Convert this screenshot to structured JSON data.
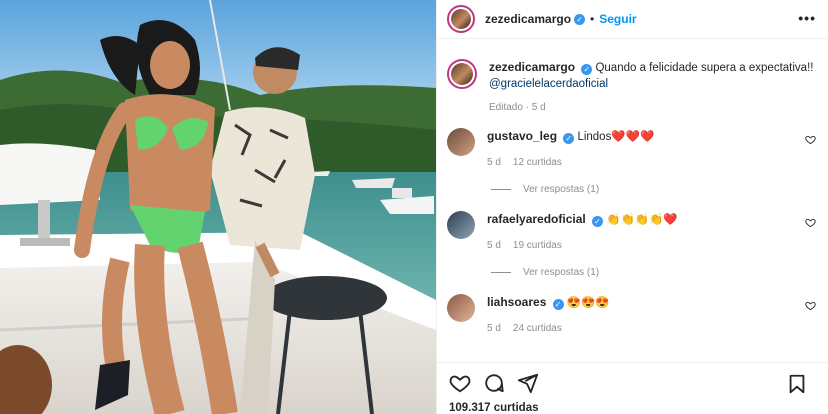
{
  "post": {
    "username": "zezedicamargo",
    "follow_label": "Seguir",
    "more_label": "•••",
    "separator": "•"
  },
  "caption": {
    "username": "zezedicamargo",
    "text": "Quando a felicidade supera a expectativa!!",
    "mention": "@gracielelacerdaoficial",
    "edited": "Editado · 5 d"
  },
  "comments": [
    {
      "username": "gustavo_leg",
      "text": "Lindos❤️❤️❤️",
      "time": "5 d",
      "likes": "12 curtidas",
      "replies": "Ver respostas (1)"
    },
    {
      "username": "rafaelyaredoficial",
      "text": "👏👏👏👏❤️",
      "time": "5 d",
      "likes": "19 curtidas",
      "replies": "Ver respostas (1)"
    },
    {
      "username": "liahsoares",
      "text": "😍😍😍",
      "time": "5 d",
      "likes": "24 curtidas"
    }
  ],
  "stats": {
    "likes": "109.317 curtidas"
  },
  "icons": {
    "like": "heart-icon",
    "comment": "comment-icon",
    "share": "share-icon",
    "save": "bookmark-icon",
    "verified": "verified-badge-icon"
  },
  "colors": {
    "follow": "#0095f6",
    "verified": "#3897f0",
    "mention": "#00376b",
    "muted": "#8e8e8e"
  }
}
